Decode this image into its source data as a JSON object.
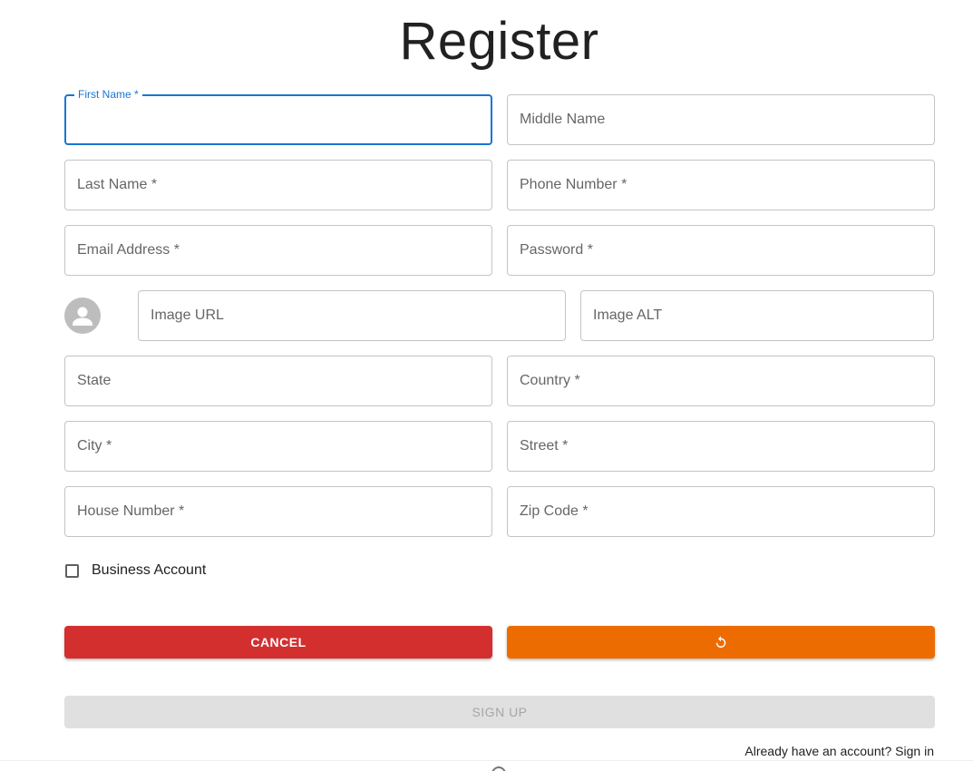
{
  "page": {
    "title": "Register"
  },
  "form": {
    "first_name": {
      "label": "First Name *",
      "value": ""
    },
    "middle_name": {
      "label": "Middle Name",
      "value": ""
    },
    "last_name": {
      "label": "Last Name *",
      "value": ""
    },
    "phone_number": {
      "label": "Phone Number *",
      "value": ""
    },
    "email_address": {
      "label": "Email Address *",
      "value": ""
    },
    "password": {
      "label": "Password *",
      "value": ""
    },
    "image_url": {
      "label": "Image URL",
      "value": ""
    },
    "image_alt": {
      "label": "Image ALT",
      "value": ""
    },
    "state": {
      "label": "State",
      "value": ""
    },
    "country": {
      "label": "Country *",
      "value": ""
    },
    "city": {
      "label": "City *",
      "value": ""
    },
    "street": {
      "label": "Street *",
      "value": ""
    },
    "house_number": {
      "label": "House Number *",
      "value": ""
    },
    "zip_code": {
      "label": "Zip Code *",
      "value": ""
    },
    "business_account": {
      "label": "Business Account",
      "checked": false
    }
  },
  "buttons": {
    "cancel_label": "CANCEL",
    "reset_icon": "refresh-icon",
    "signup_label": "SIGN UP"
  },
  "footer": {
    "signin_text": "Already have an account? Sign in"
  },
  "colors": {
    "focus": "#1976d2",
    "cancel": "#d32f2f",
    "reset": "#ed6c02",
    "disabled": "#e0e0e0",
    "avatar": "#bdbdbd"
  },
  "icons": {
    "avatar": "person-icon"
  }
}
